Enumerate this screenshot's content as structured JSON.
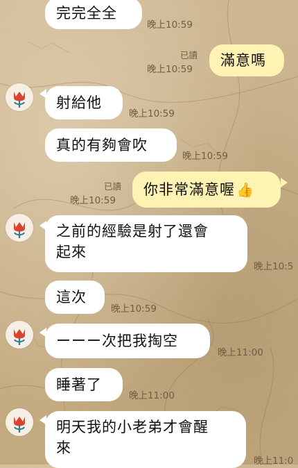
{
  "messages": [
    {
      "text": "完完全全",
      "time": "晚上10:59"
    },
    {
      "text": "滿意嗎",
      "time": "晚上10:59",
      "read": "已讀"
    },
    {
      "text": "射給他",
      "time": "晚上10:59"
    },
    {
      "text": "真的有夠會吹",
      "time": "晚上10:59"
    },
    {
      "text": "你非常滿意喔",
      "time": "晚上10:59",
      "read": "已讀",
      "emoji": "👍"
    },
    {
      "line1": "之前的經驗是射了還會",
      "line2": "起來",
      "time": "晚上10:5"
    },
    {
      "text": "這次",
      "time": "晚上10:59"
    },
    {
      "text": "ーーー次把我掏空",
      "time": "晚上11:00"
    },
    {
      "text": "睡著了",
      "time": "晚上11:00"
    },
    {
      "line1": "明天我的小老弟才會醒",
      "line2": "來",
      "time": "晚上11:0"
    }
  ],
  "colors": {
    "incoming_bubble": "#ffffff",
    "outgoing_bubble": "#fff3b3",
    "timestamp": "#6e5c44",
    "avatar_flower": "#d9432f",
    "avatar_stem": "#2f7f8f"
  },
  "avatar_icon": "red-tulip-icon"
}
